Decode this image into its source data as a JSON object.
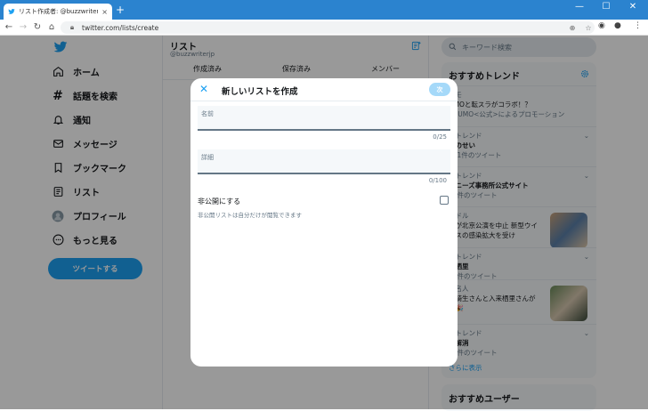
{
  "browser": {
    "tab_title": "リスト作成者: @buzzwriterjp / Twi",
    "url": "twitter.com/lists/create",
    "new_tab": "+",
    "close_tab": "×"
  },
  "sidebar": {
    "items": [
      {
        "label": "ホーム",
        "icon": "home-icon"
      },
      {
        "label": "話題を検索",
        "icon": "hashtag-icon"
      },
      {
        "label": "通知",
        "icon": "bell-icon"
      },
      {
        "label": "メッセージ",
        "icon": "envelope-icon"
      },
      {
        "label": "ブックマーク",
        "icon": "bookmark-icon"
      },
      {
        "label": "リスト",
        "icon": "list-icon"
      },
      {
        "label": "プロフィール",
        "icon": "avatar-icon"
      },
      {
        "label": "もっと見る",
        "icon": "more-icon"
      }
    ],
    "tweet_button": "ツイートする"
  },
  "center": {
    "title": "リスト",
    "handle": "@buzzwriterjp",
    "tabs": [
      "作成済み",
      "保存済み",
      "メンバー"
    ]
  },
  "right": {
    "search_placeholder": "キーワード検索",
    "trends_title": "おすすめトレンド",
    "trends": [
      {
        "category": "スモ",
        "name": "UMOと転スラがコラボ！？",
        "count": "SUUMO<公式>によるプロモーション"
      },
      {
        "category": "のトレンド",
        "name": "雨のせい",
        "count": "371件のツイート"
      },
      {
        "category": "のトレンド",
        "name": "ャニーズ事務所公式サイト",
        "count": "43件のツイート"
      },
      {
        "category": "イドル",
        "name": "嵐が北京公演を中止 新型ウイ",
        "count": "ルスの感染拡大を受け"
      },
      {
        "category": "のトレンド",
        "name": "来栖里",
        "count": "67件のツイート"
      },
      {
        "category": "著名人",
        "name": "本騎生さんと入来栖里さんが",
        "count": "婚🎉"
      },
      {
        "category": "のトレンド",
        "name": "歌解消",
        "count": "47件のツイート"
      }
    ],
    "show_more": "さらに表示",
    "users_title": "おすすめユーザー"
  },
  "modal": {
    "title": "新しいリストを作成",
    "next_button": "次",
    "name_label": "名前",
    "name_value": "",
    "name_counter": "0/25",
    "desc_label": "詳細",
    "desc_value": "",
    "desc_counter": "0/100",
    "private_label": "非公開にする",
    "private_sub": "非公開リストは自分だけが閲覧できます",
    "private_checked": false
  },
  "colors": {
    "accent": "#1da1f2",
    "titlebar": "#2b83cf",
    "overlay": "rgba(0,0,0,0.4)"
  }
}
